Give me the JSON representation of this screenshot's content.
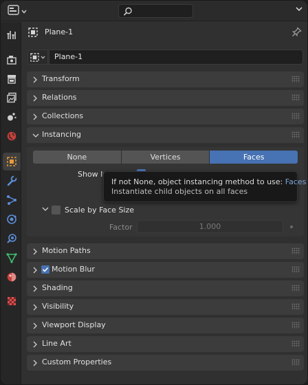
{
  "header": {
    "editor_type_icon": "properties-editor-icon",
    "search_icon": "search-icon",
    "collapse_icon": "chevron-down-icon"
  },
  "tabs": [
    {
      "name": "tool",
      "icon": "tool-icon",
      "active": false
    },
    {
      "name": "render",
      "icon": "render-icon",
      "active": false
    },
    {
      "name": "output",
      "icon": "output-icon",
      "active": false
    },
    {
      "name": "view-layer",
      "icon": "view-layer-icon",
      "active": false
    },
    {
      "name": "scene",
      "icon": "scene-icon",
      "active": false
    },
    {
      "name": "world",
      "icon": "world-icon",
      "active": false
    },
    {
      "name": "object",
      "icon": "object-icon",
      "active": true
    },
    {
      "name": "modifiers",
      "icon": "wrench-icon",
      "active": false
    },
    {
      "name": "particles",
      "icon": "particles-icon",
      "active": false
    },
    {
      "name": "physics",
      "icon": "physics-icon",
      "active": false
    },
    {
      "name": "constraints",
      "icon": "constraints-icon",
      "active": false
    },
    {
      "name": "data",
      "icon": "mesh-data-icon",
      "active": false
    },
    {
      "name": "material",
      "icon": "material-icon",
      "active": false
    },
    {
      "name": "texture",
      "icon": "texture-icon",
      "active": false
    }
  ],
  "object": {
    "title": "Plane-1",
    "name_value": "Plane-1"
  },
  "panels": {
    "transform": "Transform",
    "relations": "Relations",
    "collections": "Collections",
    "instancing": "Instancing",
    "motion_paths": "Motion Paths",
    "motion_blur": "Motion Blur",
    "shading": "Shading",
    "visibility": "Visibility",
    "viewport_display": "Viewport Display",
    "line_art": "Line Art",
    "custom_properties": "Custom Properties"
  },
  "instancing": {
    "options": [
      "None",
      "Vertices",
      "Faces"
    ],
    "selected": "Faces",
    "show_instancer_label": "Show In",
    "show_instancer_checked": true,
    "scale_by_face_size_label": "Scale by Face Size",
    "scale_by_face_size_checked": false,
    "factor_label": "Factor",
    "factor_value": "1.000"
  },
  "motion_blur_checked": true,
  "tooltip": {
    "line1_prefix": "If not None, object instancing method to use:",
    "line1_value": "Faces",
    "line2": "Instantiate child objects on all faces"
  },
  "colors": {
    "accent": "#4772b3",
    "tooltip_highlight": "#7ba3d9"
  }
}
